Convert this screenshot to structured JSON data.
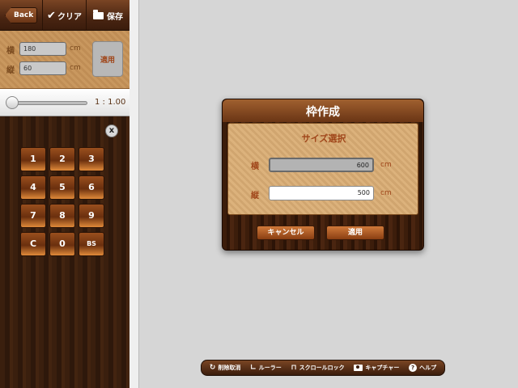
{
  "toolbar": {
    "back_label": "Back",
    "clear_label": "クリア",
    "save_label": "保存"
  },
  "size_panel": {
    "width_label": "横",
    "height_label": "縦",
    "width_value": "180",
    "height_value": "60",
    "unit": "cm",
    "apply_label": "適用"
  },
  "zoom": {
    "label": "1 : 1.00",
    "fraction": 0.0
  },
  "keypad": {
    "close_label": "x",
    "keys": [
      "1",
      "2",
      "3",
      "4",
      "5",
      "6",
      "7",
      "8",
      "9",
      "C",
      "0",
      "BS"
    ]
  },
  "dialog": {
    "title": "枠作成",
    "subtitle": "サイズ選択",
    "width_label": "横",
    "height_label": "縦",
    "width_value": "600",
    "height_value": "500",
    "unit": "cm",
    "cancel_label": "キャンセル",
    "apply_label": "適用"
  },
  "bottom_bar": {
    "undo_label": "削除取消",
    "ruler_label": "ルーラー",
    "scroll_lock_label": "スクロールロック",
    "capture_label": "キャプチャー",
    "help_label": "ヘルプ"
  },
  "colors": {
    "wood_dark": "#2a160b",
    "wood_mid": "#6a3515",
    "accent_orange": "#a0461a",
    "canvas_bg": "#d6d6d6"
  }
}
